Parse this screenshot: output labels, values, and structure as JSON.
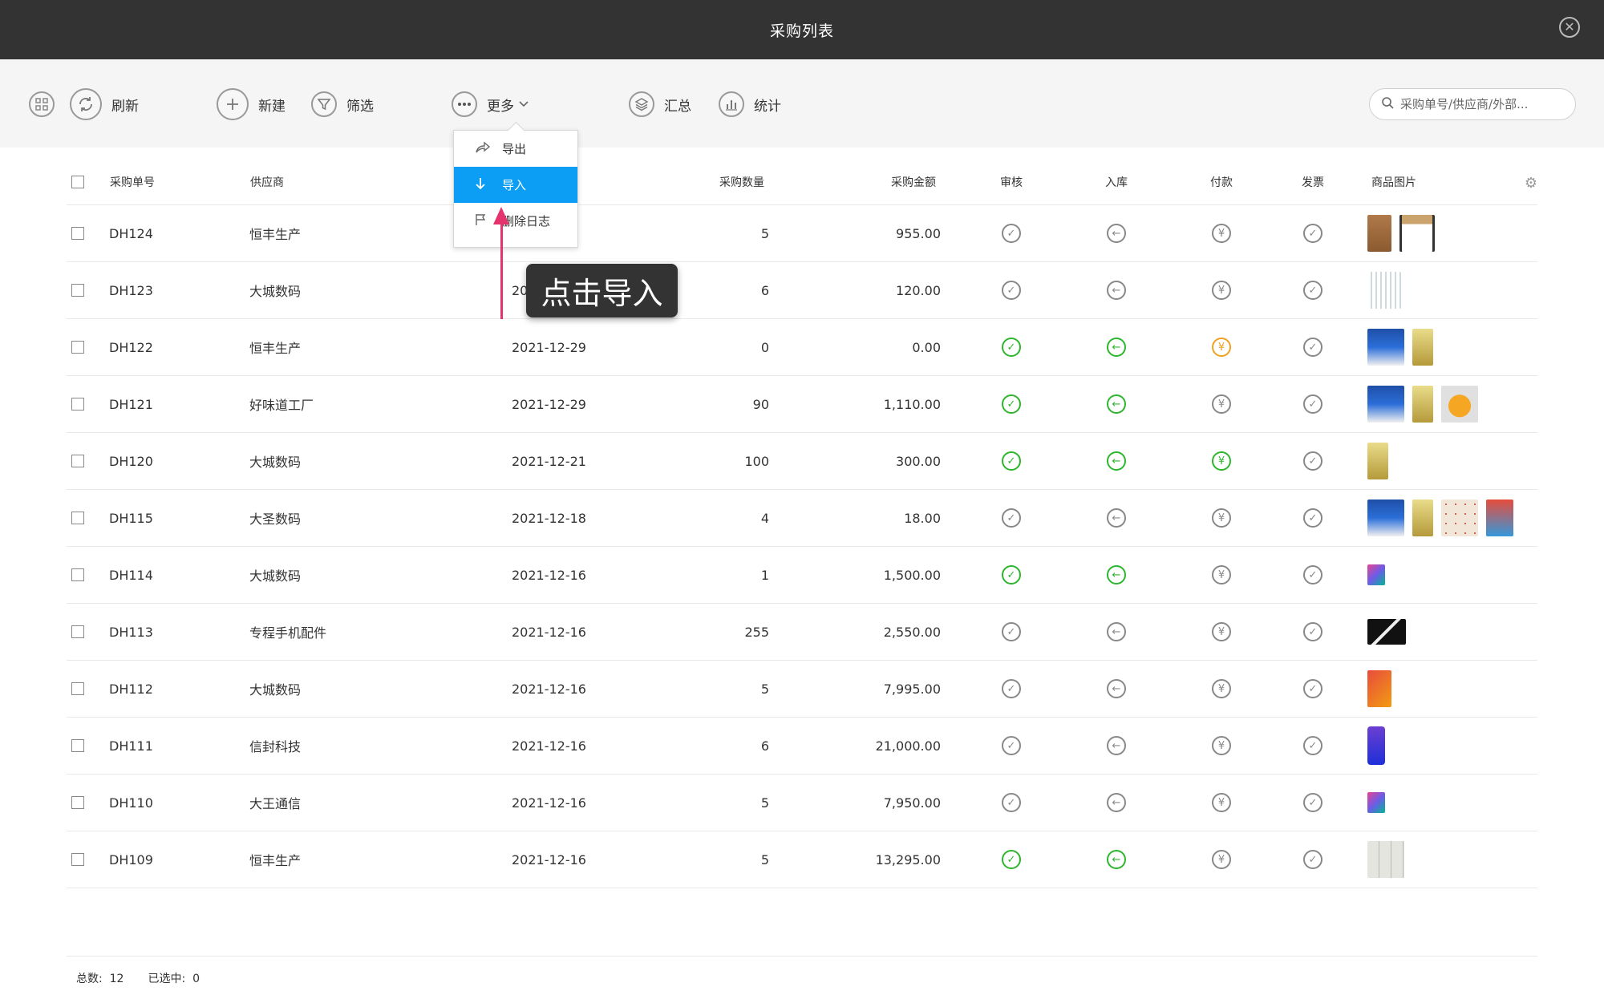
{
  "window": {
    "title": "采购列表"
  },
  "toolbar": {
    "refresh_label": "刷新",
    "new_label": "新建",
    "filter_label": "筛选",
    "more_label": "更多",
    "summary_label": "汇总",
    "stats_label": "统计",
    "search_placeholder": "采购单号/供应商/外部..."
  },
  "dropdown": {
    "items": [
      {
        "label": "导出",
        "icon": "share-icon",
        "active": false
      },
      {
        "label": "导入",
        "icon": "download-arrow-icon",
        "active": true
      },
      {
        "label": "删除日志",
        "icon": "flag-icon",
        "active": false
      }
    ]
  },
  "tooltip": {
    "text": "点击导入"
  },
  "table": {
    "headers": {
      "order_no": "采购单号",
      "supplier": "供应商",
      "qty": "采购数量",
      "amount": "采购金额",
      "audit": "审核",
      "stock_in": "入库",
      "payment": "付款",
      "invoice": "发票",
      "images": "商品图片"
    },
    "rows": [
      {
        "order_no": "DH124",
        "supplier": "恒丰生产",
        "date": "",
        "qty": "5",
        "amount": "955.00",
        "audit": "grey",
        "stock_in": "grey",
        "payment": "grey",
        "invoice": "grey",
        "images": [
          "chair",
          "stool"
        ]
      },
      {
        "order_no": "DH123",
        "supplier": "大城数码",
        "date": "2021",
        "qty": "6",
        "amount": "120.00",
        "audit": "grey",
        "stock_in": "grey",
        "payment": "grey",
        "invoice": "grey",
        "images": [
          "cables"
        ]
      },
      {
        "order_no": "DH122",
        "supplier": "恒丰生产",
        "date": "2021-12-29",
        "qty": "0",
        "amount": "0.00",
        "audit": "green",
        "stock_in": "green",
        "payment": "orange",
        "invoice": "grey",
        "images": [
          "snack-box",
          "snack-pack"
        ]
      },
      {
        "order_no": "DH121",
        "supplier": "好味道工厂",
        "date": "2021-12-29",
        "qty": "90",
        "amount": "1,110.00",
        "audit": "green",
        "stock_in": "green",
        "payment": "grey",
        "invoice": "grey",
        "images": [
          "snack-box",
          "snack-pack",
          "bread"
        ]
      },
      {
        "order_no": "DH120",
        "supplier": "大城数码",
        "date": "2021-12-21",
        "qty": "100",
        "amount": "300.00",
        "audit": "green",
        "stock_in": "green",
        "payment": "green",
        "invoice": "grey",
        "images": [
          "snack-pack"
        ]
      },
      {
        "order_no": "DH115",
        "supplier": "大圣数码",
        "date": "2021-12-18",
        "qty": "4",
        "amount": "18.00",
        "audit": "grey",
        "stock_in": "grey",
        "payment": "grey",
        "invoice": "grey",
        "images": [
          "snack-box",
          "snack-pack",
          "cookies",
          "chips"
        ]
      },
      {
        "order_no": "DH114",
        "supplier": "大城数码",
        "date": "2021-12-16",
        "qty": "1",
        "amount": "1,500.00",
        "audit": "green",
        "stock_in": "green",
        "payment": "grey",
        "invoice": "grey",
        "images": [
          "file"
        ]
      },
      {
        "order_no": "DH113",
        "supplier": "专程手机配件",
        "date": "2021-12-16",
        "qty": "255",
        "amount": "2,550.00",
        "audit": "grey",
        "stock_in": "grey",
        "payment": "grey",
        "invoice": "grey",
        "images": [
          "cable-black"
        ]
      },
      {
        "order_no": "DH112",
        "supplier": "大城数码",
        "date": "2021-12-16",
        "qty": "5",
        "amount": "7,995.00",
        "audit": "grey",
        "stock_in": "grey",
        "payment": "grey",
        "invoice": "grey",
        "images": [
          "phone-orange"
        ]
      },
      {
        "order_no": "DH111",
        "supplier": "信封科技",
        "date": "2021-12-16",
        "qty": "6",
        "amount": "21,000.00",
        "audit": "grey",
        "stock_in": "grey",
        "payment": "grey",
        "invoice": "grey",
        "images": [
          "phone-blue"
        ]
      },
      {
        "order_no": "DH110",
        "supplier": "大王通信",
        "date": "2021-12-16",
        "qty": "5",
        "amount": "7,950.00",
        "audit": "grey",
        "stock_in": "grey",
        "payment": "grey",
        "invoice": "grey",
        "images": [
          "file"
        ]
      },
      {
        "order_no": "DH109",
        "supplier": "恒丰生产",
        "date": "2021-12-16",
        "qty": "5",
        "amount": "13,295.00",
        "audit": "green",
        "stock_in": "green",
        "payment": "grey",
        "invoice": "grey",
        "images": [
          "cabinet"
        ]
      }
    ]
  },
  "footer": {
    "total_label": "总数:",
    "total_value": "12",
    "selected_label": "已选中:",
    "selected_value": "0"
  },
  "colors": {
    "titlebar": "#333333",
    "accent": "#0c9ef5",
    "green": "#2db52d",
    "orange": "#f0a020",
    "arrow": "#e5336e"
  }
}
